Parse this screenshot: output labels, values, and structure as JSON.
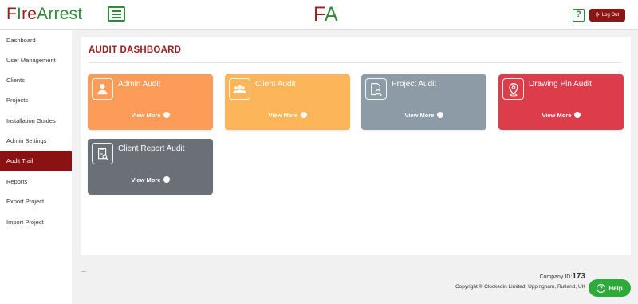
{
  "header": {
    "logo_prefix": "F",
    "logo_i": "I",
    "logo_re": "re",
    "logo_arrest": "Arrest",
    "center_logo_f": "F",
    "center_logo_a": "A",
    "help_glyph": "?",
    "logout_label": "Log Out",
    "icons": {
      "menu": "hamburger-icon",
      "help": "question-icon",
      "logout": "sign-out-icon"
    }
  },
  "sidebar": {
    "items": [
      {
        "label": "Dashboard",
        "active": false
      },
      {
        "label": "User Management",
        "active": false
      },
      {
        "label": "Clients",
        "active": false
      },
      {
        "label": "Projects",
        "active": false
      },
      {
        "label": "Installation Guides",
        "active": false
      },
      {
        "label": "Admin Settings",
        "active": false
      },
      {
        "label": "Audit Trail",
        "active": true
      },
      {
        "label": "Reports",
        "active": false
      },
      {
        "label": "Export Project",
        "active": false
      },
      {
        "label": "Import Project",
        "active": false
      }
    ],
    "active_color": "#8b1212"
  },
  "main": {
    "title": "AUDIT DASHBOARD",
    "cards": [
      {
        "title": "Admin Audit",
        "link": "View More",
        "icon": "user-icon",
        "color": "#fd9b58"
      },
      {
        "title": "Client Audit",
        "link": "View More",
        "icon": "users-group-icon",
        "color": "#fcb558"
      },
      {
        "title": "Project Audit",
        "link": "View More",
        "icon": "file-search-icon",
        "color": "#8c9ba5"
      },
      {
        "title": "Drawing Pin Audit",
        "link": "View More",
        "icon": "map-pin-icon",
        "color": "#dd3d4a"
      },
      {
        "title": "Client Report Audit",
        "link": "View More",
        "icon": "report-search-icon",
        "color": "#6b7077"
      }
    ]
  },
  "footer": {
    "company_label": "Company ID:",
    "company_id": "173",
    "copyright": "Copyright © Clockedin Limited, Uppingham, Rutland, UK",
    "help_label": "Help"
  },
  "colors": {
    "brand_red": "#9b1c1c",
    "brand_green": "#2f8a3a",
    "help_green": "#2daa3a"
  }
}
